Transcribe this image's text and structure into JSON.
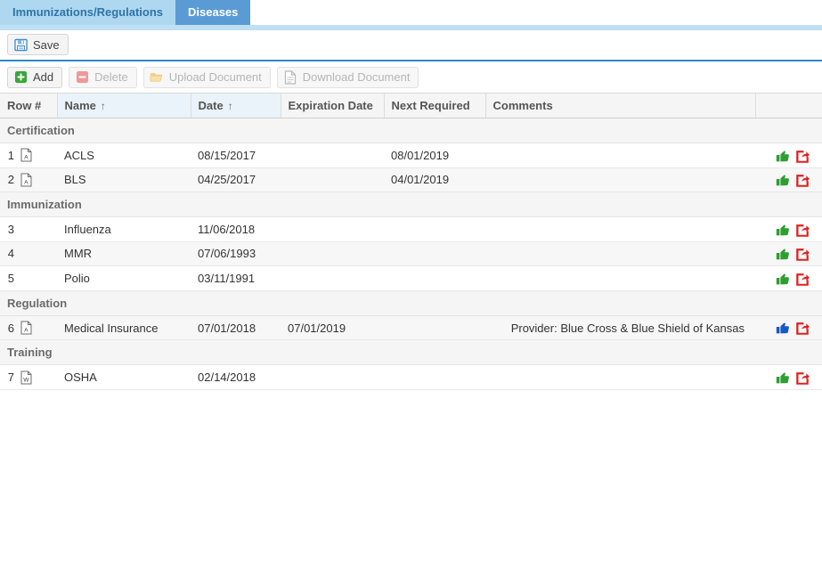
{
  "tabs": [
    {
      "label": "Immunizations/Regulations",
      "active": false
    },
    {
      "label": "Diseases",
      "active": true
    }
  ],
  "save_toolbar": {
    "save_label": "Save",
    "save_icon": "floppy-disk-icon"
  },
  "action_toolbar": {
    "buttons": [
      {
        "label": "Add",
        "icon": "plus-square-icon",
        "enabled": true
      },
      {
        "label": "Delete",
        "icon": "minus-square-icon",
        "enabled": false
      },
      {
        "label": "Upload Document",
        "icon": "folder-open-icon",
        "enabled": false
      },
      {
        "label": "Download Document",
        "icon": "document-icon",
        "enabled": false
      }
    ]
  },
  "grid": {
    "columns": [
      {
        "label": "Row #",
        "sorted": false
      },
      {
        "label": "Name",
        "sorted": true,
        "sort_arrow": "↑"
      },
      {
        "label": "Date",
        "sorted": true,
        "sort_arrow": "↑"
      },
      {
        "label": "Expiration Date",
        "sorted": false
      },
      {
        "label": "Next Required",
        "sorted": false
      },
      {
        "label": "Comments",
        "sorted": false
      },
      {
        "label": "",
        "sorted": false
      }
    ],
    "groups": [
      {
        "label": "Certification",
        "rows": [
          {
            "row_num": "1",
            "doc_icon": "pdf-icon",
            "name": "ACLS",
            "date": "08/15/2017",
            "expiration_date": "",
            "next_required": "08/01/2019",
            "comments": "",
            "thumb_icon": "thumbs-up-icon",
            "thumb_color": "#2e9e32",
            "share_icon": "share-export-icon",
            "share_color": "#e02020"
          },
          {
            "row_num": "2",
            "doc_icon": "pdf-icon",
            "name": "BLS",
            "date": "04/25/2017",
            "expiration_date": "",
            "next_required": "04/01/2019",
            "comments": "",
            "thumb_icon": "thumbs-up-icon",
            "thumb_color": "#2e9e32",
            "share_icon": "share-export-icon",
            "share_color": "#e02020"
          }
        ]
      },
      {
        "label": "Immunization",
        "rows": [
          {
            "row_num": "3",
            "doc_icon": "",
            "name": "Influenza",
            "date": "11/06/2018",
            "expiration_date": "",
            "next_required": "",
            "comments": "",
            "thumb_icon": "thumbs-up-icon",
            "thumb_color": "#2e9e32",
            "share_icon": "share-export-icon",
            "share_color": "#e02020"
          },
          {
            "row_num": "4",
            "doc_icon": "",
            "name": "MMR",
            "date": "07/06/1993",
            "expiration_date": "",
            "next_required": "",
            "comments": "",
            "thumb_icon": "thumbs-up-icon",
            "thumb_color": "#2e9e32",
            "share_icon": "share-export-icon",
            "share_color": "#e02020"
          },
          {
            "row_num": "5",
            "doc_icon": "",
            "name": "Polio",
            "date": "03/11/1991",
            "expiration_date": "",
            "next_required": "",
            "comments": "",
            "thumb_icon": "thumbs-up-icon",
            "thumb_color": "#2e9e32",
            "share_icon": "share-export-icon",
            "share_color": "#e02020"
          }
        ]
      },
      {
        "label": "Regulation",
        "rows": [
          {
            "row_num": "6",
            "doc_icon": "pdf-icon",
            "name": "Medical Insurance",
            "date": "07/01/2018",
            "expiration_date": "07/01/2019",
            "next_required": "",
            "comments": "Provider: Blue Cross & Blue Shield of Kansas",
            "thumb_icon": "thumbs-up-icon",
            "thumb_color": "#1658c8",
            "share_icon": "share-export-icon",
            "share_color": "#e02020"
          }
        ]
      },
      {
        "label": "Training",
        "rows": [
          {
            "row_num": "7",
            "doc_icon": "word-icon",
            "name": "OSHA",
            "date": "02/14/2018",
            "expiration_date": "",
            "next_required": "",
            "comments": "",
            "thumb_icon": "thumbs-up-icon",
            "thumb_color": "#2e9e32",
            "share_icon": "share-export-icon",
            "share_color": "#e02020"
          }
        ]
      }
    ]
  },
  "colors": {
    "tab_active_bg": "#5b9bd5",
    "tab_inactive_bg": "#aed8ef",
    "tab_inactive_text": "#2f73a8",
    "toolbar_divider": "#2f86c8",
    "header_bg": "#f5f5f5",
    "header_sorted_bg": "#eaf3fa",
    "group_bg": "#f5f5f5",
    "row_alt_bg": "#f7f7f7"
  }
}
